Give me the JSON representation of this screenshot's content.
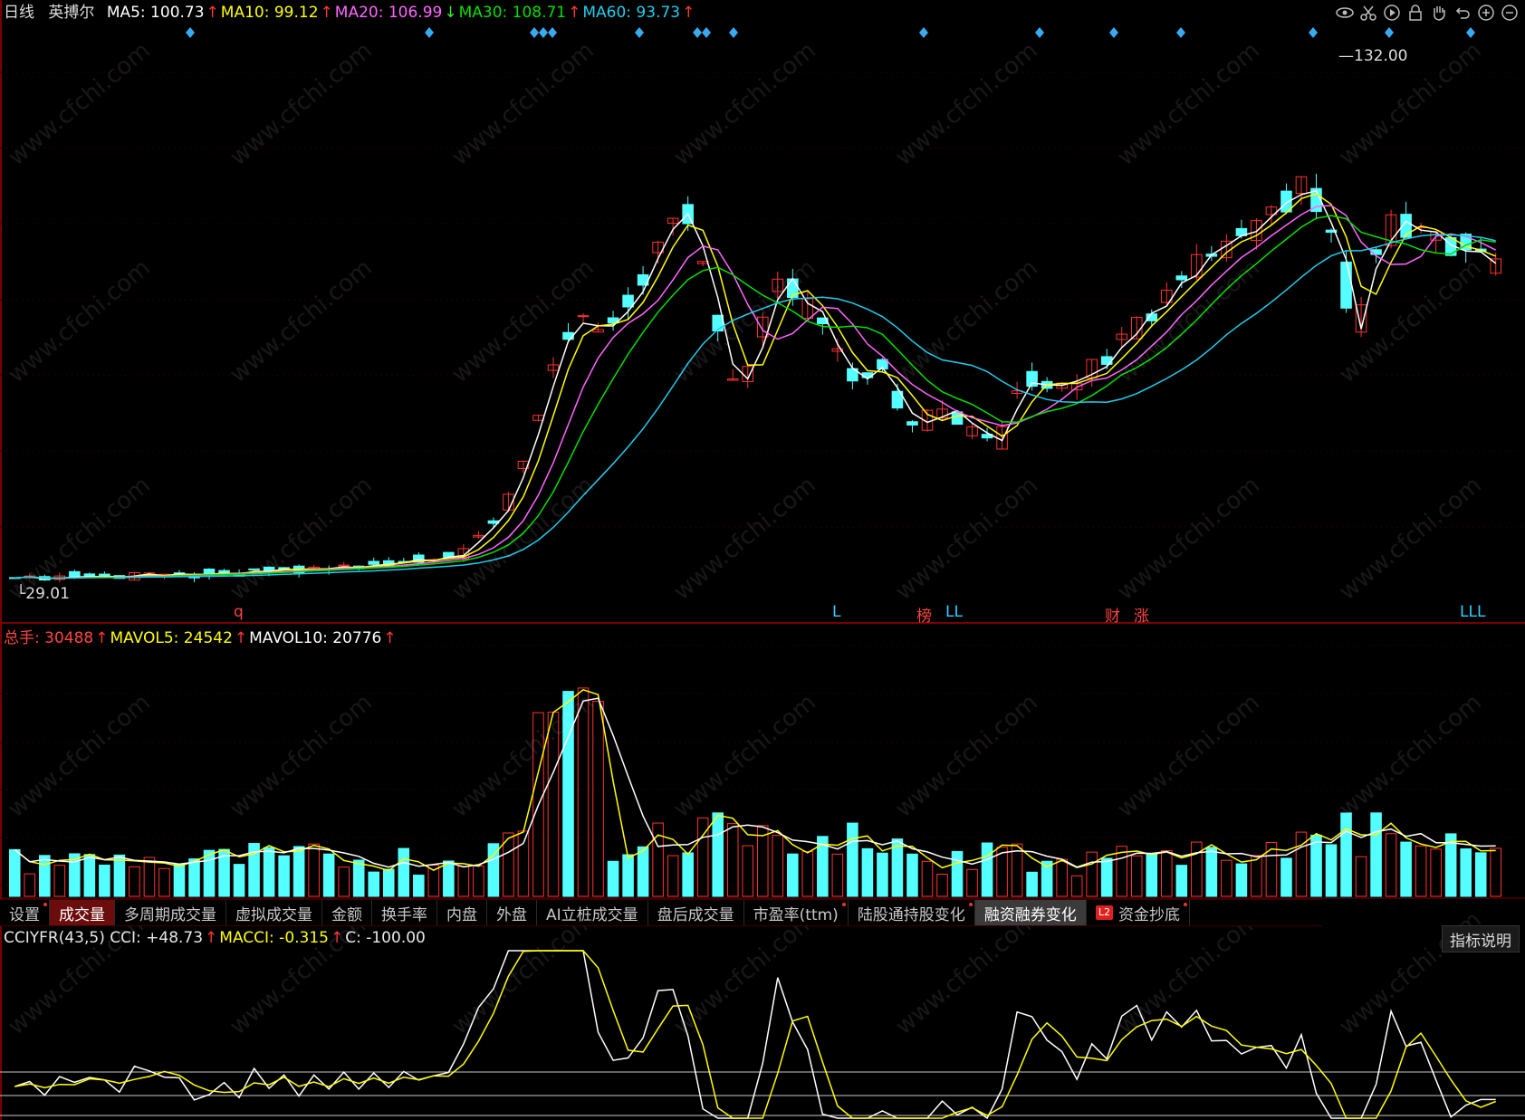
{
  "price_panel": {
    "period": "日线",
    "stock_name": "英搏尔",
    "ma": [
      {
        "label": "MA5: 100.73",
        "arrow": "↑",
        "color": "#ffffff"
      },
      {
        "label": "MA10: 99.12",
        "arrow": "↑",
        "color": "#ffff00"
      },
      {
        "label": "MA20: 106.99",
        "arrow": "↓",
        "color": "#ff66ff"
      },
      {
        "label": "MA30: 108.71",
        "arrow": "↑",
        "color": "#00e000"
      },
      {
        "label": "MA60: 93.73",
        "arrow": "↑",
        "color": "#22ccee"
      }
    ],
    "high_label": "132.00",
    "low_label": "29.01",
    "bottom_markers": [
      {
        "text": "q",
        "color": "#ff4444"
      },
      {
        "text": "L",
        "color": "#33ccff"
      },
      {
        "text": "榜",
        "color": "#ff4444"
      },
      {
        "text": "LL",
        "color": "#33ccff"
      },
      {
        "text": "财",
        "color": "#ff4444"
      },
      {
        "text": "涨",
        "color": "#ff4444"
      },
      {
        "text": "LLL",
        "color": "#33ccff"
      }
    ]
  },
  "volume_panel": {
    "legend": [
      {
        "label": "总手: 30488",
        "arrow": "↑",
        "color": "#ff4444"
      },
      {
        "label": "MAVOL5: 24542",
        "arrow": "↑",
        "color": "#ffff00"
      },
      {
        "label": "MAVOL10: 20776",
        "arrow": "↑",
        "color": "#ffffff"
      }
    ]
  },
  "tabs": [
    {
      "label": "设置",
      "state": "normal",
      "dot": true
    },
    {
      "label": "成交量",
      "state": "red",
      "dot": false
    },
    {
      "label": "多周期成交量",
      "state": "normal",
      "dot": false
    },
    {
      "label": "虚拟成交量",
      "state": "normal",
      "dot": false
    },
    {
      "label": "金额",
      "state": "normal",
      "dot": false
    },
    {
      "label": "换手率",
      "state": "normal",
      "dot": false
    },
    {
      "label": "内盘",
      "state": "normal",
      "dot": false
    },
    {
      "label": "外盘",
      "state": "normal",
      "dot": false
    },
    {
      "label": "AI立桩成交量",
      "state": "normal",
      "dot": false
    },
    {
      "label": "盘后成交量",
      "state": "normal",
      "dot": false
    },
    {
      "label": "市盈率(ttm)",
      "state": "normal",
      "dot": true
    },
    {
      "label": "陆股通持股变化",
      "state": "normal",
      "dot": true
    },
    {
      "label": "融资融券变化",
      "state": "grey",
      "dot": false
    },
    {
      "label": "资金抄底",
      "state": "normal",
      "dot": true,
      "badge": "L2"
    }
  ],
  "indicator_panel": {
    "legend": [
      {
        "label": "CCIYFR(43,5) CCI: +48.73",
        "arrow": "↑",
        "color": "#e8e8e8"
      },
      {
        "label": "MACCI: -0.315",
        "arrow": "↑",
        "color": "#ffff00"
      },
      {
        "label": "C: -100.00",
        "arrow": "",
        "color": "#e8e8e8"
      }
    ],
    "help_button": "指标说明"
  },
  "toolbar_icons": [
    "eye-icon",
    "scissors-icon",
    "play-icon",
    "lock-icon",
    "hand-icon",
    "undo-icon",
    "zoom-in-icon",
    "zoom-out-icon"
  ],
  "watermark": "www.cfchi.com",
  "colors": {
    "up": "#ff3232",
    "down": "#54ffff",
    "ma5": "#ffffff",
    "ma10": "#ffff00",
    "ma20": "#ff66ff",
    "ma30": "#00e000",
    "ma60": "#22ccee"
  }
}
